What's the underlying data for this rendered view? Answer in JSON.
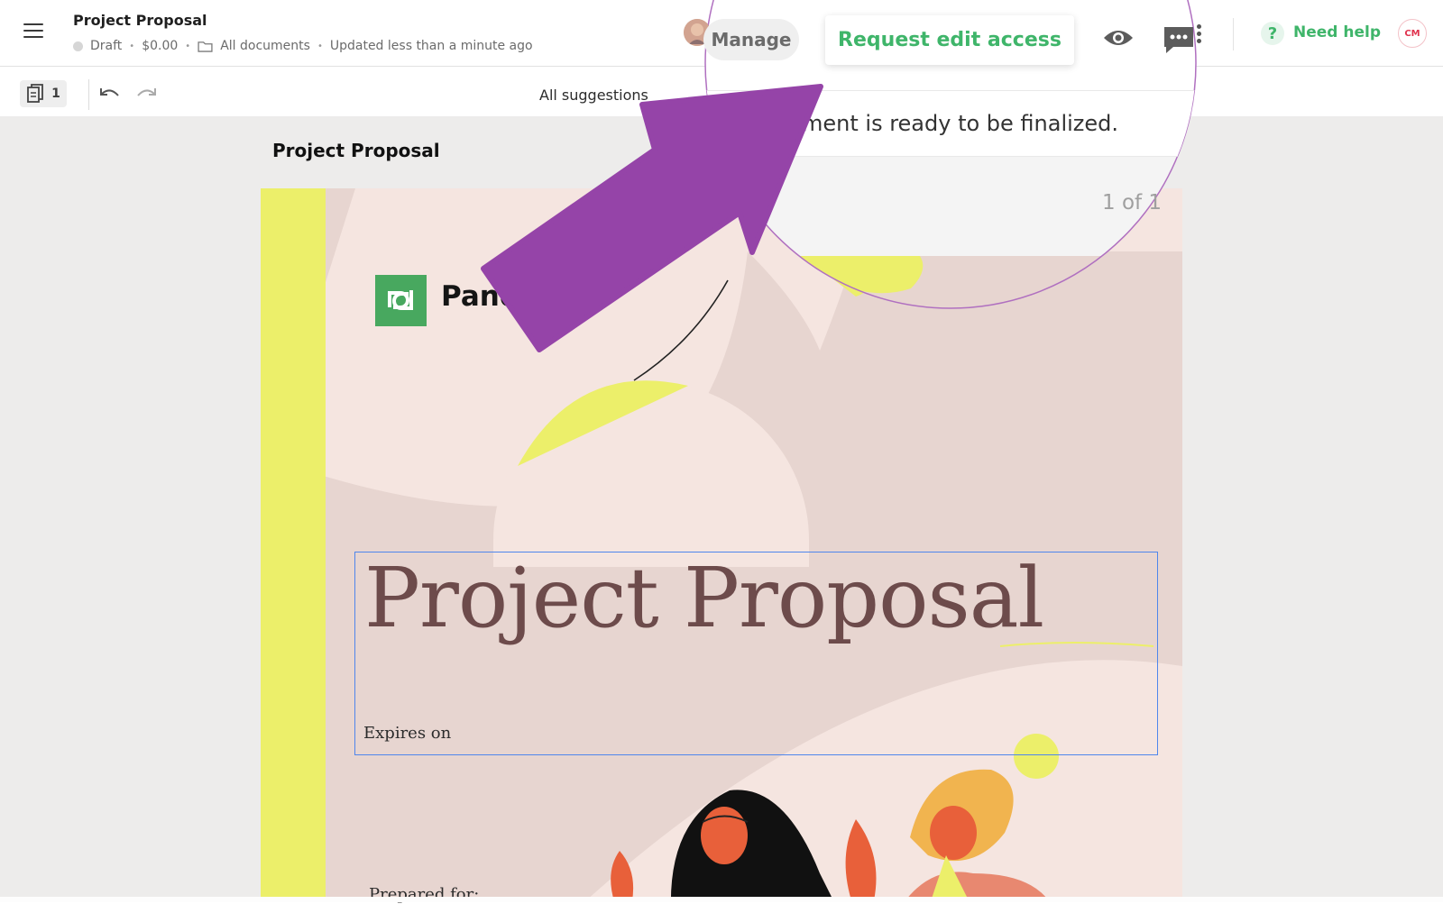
{
  "header": {
    "doc_title": "Project Proposal",
    "status": "Draft",
    "price": "$0.00",
    "folder": "All documents",
    "updated": "Updated less than a minute ago",
    "manage_label": "Manage",
    "request_label": "Request edit access",
    "help_label": "Need help",
    "user_initials": "CM"
  },
  "toolbar": {
    "pages_count": "1",
    "suggestions_text": "All suggestions"
  },
  "magnifier": {
    "banner_text": "ment is ready to be finalized.",
    "page_count": "1 of 1"
  },
  "document": {
    "page_label": "Project Proposal",
    "brand_partial": "Pand",
    "title": "Project Proposal",
    "expires_label": "Expires on",
    "prepared_label": "Prepared for:"
  },
  "colors": {
    "accent_green": "#3fb56a",
    "arrow_purple": "#9544a8",
    "accent_yellow": "#ecef6a",
    "title_brown": "#6d4b4b",
    "selection_blue": "#4f86ec"
  }
}
